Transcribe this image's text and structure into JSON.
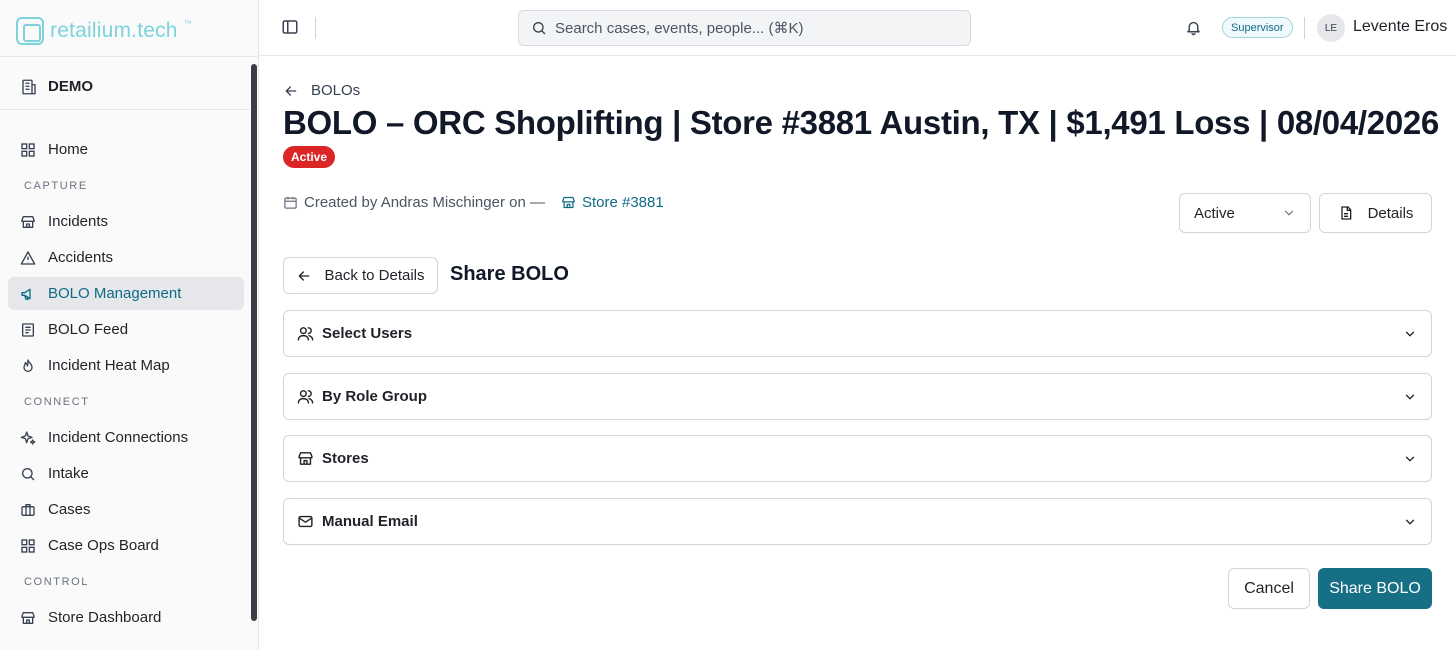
{
  "brand": {
    "name": "retailium.tech",
    "tm": "™"
  },
  "tenant": {
    "label": "DEMO"
  },
  "sidebar": {
    "items": [
      {
        "label": "Home"
      },
      {
        "section": "CAPTURE"
      },
      {
        "label": "Incidents"
      },
      {
        "label": "Accidents"
      },
      {
        "label": "BOLO Management",
        "active": true
      },
      {
        "label": "BOLO Feed"
      },
      {
        "label": "Incident Heat Map"
      },
      {
        "section": "CONNECT"
      },
      {
        "label": "Incident Connections"
      },
      {
        "label": "Intake"
      },
      {
        "label": "Cases"
      },
      {
        "label": "Case Ops Board"
      },
      {
        "section": "CONTROL"
      },
      {
        "label": "Store Dashboard"
      }
    ]
  },
  "header": {
    "search_placeholder": "Search cases, events, people... (⌘K)",
    "role": "Supervisor",
    "user_initials": "LE",
    "user_name": "Levente Eros"
  },
  "page": {
    "back_label": "BOLOs",
    "title": "BOLO – ORC Shoplifting | Store #3881 Austin, TX | $1,491 Loss | 08/04/2026",
    "status_badge": "Active",
    "created_by": "Created by Andras Mischinger on —",
    "store_link": "Store #3881",
    "status_select": "Active",
    "details_button": "Details"
  },
  "share": {
    "back_button": "Back to Details",
    "title": "Share BOLO",
    "sections": [
      {
        "label": "Select Users",
        "icon": "users-icon"
      },
      {
        "label": "By Role Group",
        "icon": "users-icon"
      },
      {
        "label": "Stores",
        "icon": "store-icon"
      },
      {
        "label": "Manual Email",
        "icon": "mail-icon"
      }
    ],
    "cancel": "Cancel",
    "submit": "Share BOLO"
  },
  "colors": {
    "accent": "#176f86",
    "brand": "#7dd3dc",
    "danger": "#dc2626"
  }
}
